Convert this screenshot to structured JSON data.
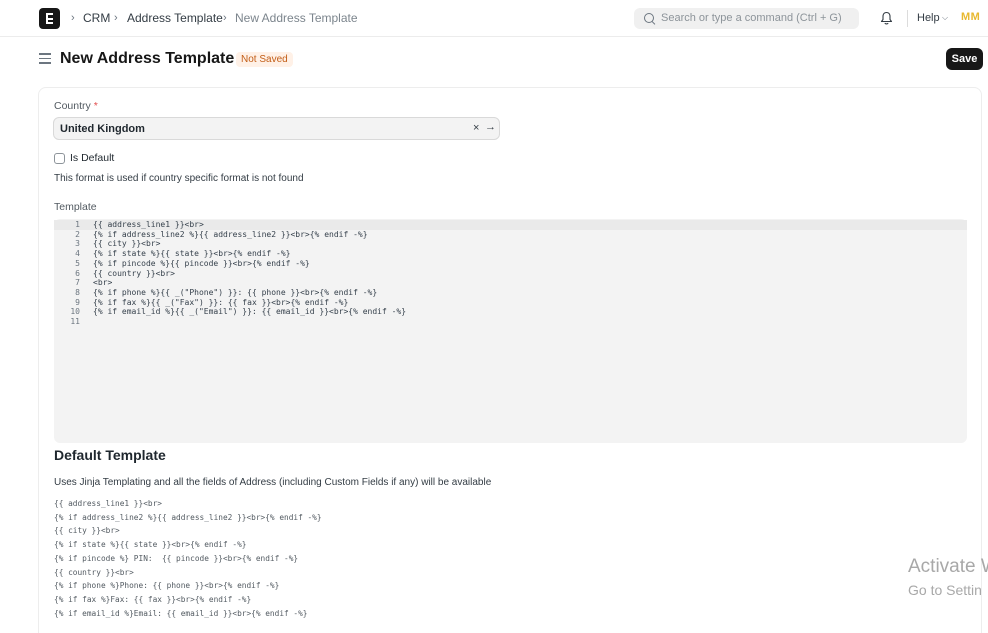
{
  "navbar": {
    "breadcrumbs": [
      "CRM",
      "Address Template",
      "New Address Template"
    ],
    "search_placeholder": "Search or type a command (Ctrl + G)",
    "help_label": "Help",
    "avatar_initials": "MM"
  },
  "page": {
    "title": "New Address Template",
    "status": "Not Saved",
    "save_label": "Save"
  },
  "form": {
    "country_label": "Country",
    "country_required_mark": "*",
    "country_value": "United Kingdom",
    "is_default_label": "Is Default",
    "is_default_checked": false,
    "is_default_help": "This format is used if country specific format is not found",
    "template_label": "Template",
    "template_lines": [
      {
        "n": "1",
        "t": "{{ address_line1 }}<br>"
      },
      {
        "n": "2",
        "t": "{% if address_line2 %}{{ address_line2 }}<br>{% endif -%}"
      },
      {
        "n": "3",
        "t": "{{ city }}<br>"
      },
      {
        "n": "4",
        "t": "{% if state %}{{ state }}<br>{% endif -%}"
      },
      {
        "n": "5",
        "t": "{% if pincode %}{{ pincode }}<br>{% endif -%}"
      },
      {
        "n": "6",
        "t": "{{ country }}<br>"
      },
      {
        "n": "7",
        "t": "<br>"
      },
      {
        "n": "8",
        "t": "{% if phone %}{{ _(\"Phone\") }}: {{ phone }}<br>{% endif -%}"
      },
      {
        "n": "9",
        "t": "{% if fax %}{{ _(\"Fax\") }}: {{ fax }}<br>{% endif -%}"
      },
      {
        "n": "10",
        "t": "{% if email_id %}{{ _(\"Email\") }}: {{ email_id }}<br>{% endif -%}"
      },
      {
        "n": "11",
        "t": ""
      }
    ]
  },
  "default_template": {
    "title": "Default Template",
    "description": "Uses Jinja Templating and all the fields of Address (including Custom Fields if any) will be available",
    "lines": [
      "{{ address_line1 }}<br>",
      "{% if address_line2 %}{{ address_line2 }}<br>{% endif -%}",
      "{{ city }}<br>",
      "{% if state %}{{ state }}<br>{% endif -%}",
      "{% if pincode %} PIN:  {{ pincode }}<br>{% endif -%}",
      "{{ country }}<br>",
      "{% if phone %}Phone: {{ phone }}<br>{% endif -%}",
      "{% if fax %}Fax: {{ fax }}<br>{% endif -%}",
      "{% if email_id %}Email: {{ email_id }}<br>{% endif -%}"
    ]
  },
  "watermark": {
    "line1": "Activate W",
    "line2": "Go to Settin"
  },
  "icons": {
    "logo": "frappe-e-logo",
    "search": "search-icon",
    "bell": "bell-icon",
    "menu": "hamburger-icon",
    "clear": "close-icon",
    "open_link": "arrow-right-icon"
  },
  "colors": {
    "primary_button": "#171717",
    "status_badge_bg": "#fff1e7",
    "status_badge_text": "#c35e17",
    "avatar_text": "#e8b82f",
    "required_mark": "#e24c4c"
  }
}
